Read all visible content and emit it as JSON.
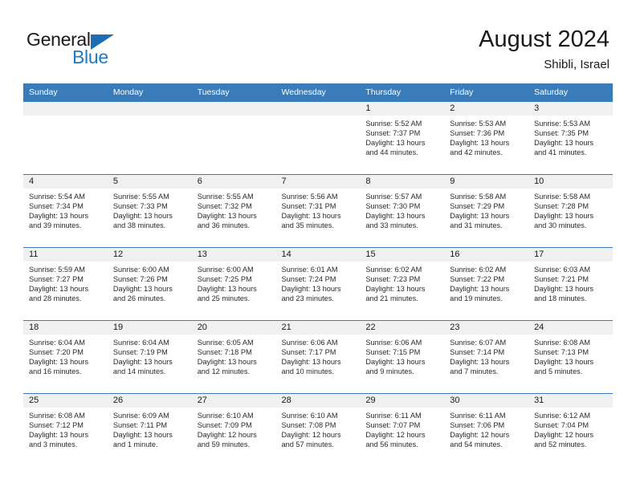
{
  "brand": {
    "line1": "General",
    "line2": "Blue",
    "triangle_color": "#1d6cb5",
    "blue_text_color": "#2278c4"
  },
  "header": {
    "title": "August 2024",
    "subtitle": "Shibli, Israel",
    "accent_color": "#3a7cba"
  },
  "weekday_headers": [
    "Sunday",
    "Monday",
    "Tuesday",
    "Wednesday",
    "Thursday",
    "Friday",
    "Saturday"
  ],
  "labels": {
    "sunrise_prefix": "Sunrise:",
    "sunset_prefix": "Sunset:",
    "daylight_prefix": "Daylight:"
  },
  "weeks": [
    [
      {
        "day": ""
      },
      {
        "day": ""
      },
      {
        "day": ""
      },
      {
        "day": ""
      },
      {
        "day": "1",
        "sunrise": "Sunrise: 5:52 AM",
        "sunset": "Sunset: 7:37 PM",
        "daylight1": "Daylight: 13 hours",
        "daylight2": "and 44 minutes."
      },
      {
        "day": "2",
        "sunrise": "Sunrise: 5:53 AM",
        "sunset": "Sunset: 7:36 PM",
        "daylight1": "Daylight: 13 hours",
        "daylight2": "and 42 minutes."
      },
      {
        "day": "3",
        "sunrise": "Sunrise: 5:53 AM",
        "sunset": "Sunset: 7:35 PM",
        "daylight1": "Daylight: 13 hours",
        "daylight2": "and 41 minutes."
      }
    ],
    [
      {
        "day": "4",
        "sunrise": "Sunrise: 5:54 AM",
        "sunset": "Sunset: 7:34 PM",
        "daylight1": "Daylight: 13 hours",
        "daylight2": "and 39 minutes."
      },
      {
        "day": "5",
        "sunrise": "Sunrise: 5:55 AM",
        "sunset": "Sunset: 7:33 PM",
        "daylight1": "Daylight: 13 hours",
        "daylight2": "and 38 minutes."
      },
      {
        "day": "6",
        "sunrise": "Sunrise: 5:55 AM",
        "sunset": "Sunset: 7:32 PM",
        "daylight1": "Daylight: 13 hours",
        "daylight2": "and 36 minutes."
      },
      {
        "day": "7",
        "sunrise": "Sunrise: 5:56 AM",
        "sunset": "Sunset: 7:31 PM",
        "daylight1": "Daylight: 13 hours",
        "daylight2": "and 35 minutes."
      },
      {
        "day": "8",
        "sunrise": "Sunrise: 5:57 AM",
        "sunset": "Sunset: 7:30 PM",
        "daylight1": "Daylight: 13 hours",
        "daylight2": "and 33 minutes."
      },
      {
        "day": "9",
        "sunrise": "Sunrise: 5:58 AM",
        "sunset": "Sunset: 7:29 PM",
        "daylight1": "Daylight: 13 hours",
        "daylight2": "and 31 minutes."
      },
      {
        "day": "10",
        "sunrise": "Sunrise: 5:58 AM",
        "sunset": "Sunset: 7:28 PM",
        "daylight1": "Daylight: 13 hours",
        "daylight2": "and 30 minutes."
      }
    ],
    [
      {
        "day": "11",
        "sunrise": "Sunrise: 5:59 AM",
        "sunset": "Sunset: 7:27 PM",
        "daylight1": "Daylight: 13 hours",
        "daylight2": "and 28 minutes."
      },
      {
        "day": "12",
        "sunrise": "Sunrise: 6:00 AM",
        "sunset": "Sunset: 7:26 PM",
        "daylight1": "Daylight: 13 hours",
        "daylight2": "and 26 minutes."
      },
      {
        "day": "13",
        "sunrise": "Sunrise: 6:00 AM",
        "sunset": "Sunset: 7:25 PM",
        "daylight1": "Daylight: 13 hours",
        "daylight2": "and 25 minutes."
      },
      {
        "day": "14",
        "sunrise": "Sunrise: 6:01 AM",
        "sunset": "Sunset: 7:24 PM",
        "daylight1": "Daylight: 13 hours",
        "daylight2": "and 23 minutes."
      },
      {
        "day": "15",
        "sunrise": "Sunrise: 6:02 AM",
        "sunset": "Sunset: 7:23 PM",
        "daylight1": "Daylight: 13 hours",
        "daylight2": "and 21 minutes."
      },
      {
        "day": "16",
        "sunrise": "Sunrise: 6:02 AM",
        "sunset": "Sunset: 7:22 PM",
        "daylight1": "Daylight: 13 hours",
        "daylight2": "and 19 minutes."
      },
      {
        "day": "17",
        "sunrise": "Sunrise: 6:03 AM",
        "sunset": "Sunset: 7:21 PM",
        "daylight1": "Daylight: 13 hours",
        "daylight2": "and 18 minutes."
      }
    ],
    [
      {
        "day": "18",
        "sunrise": "Sunrise: 6:04 AM",
        "sunset": "Sunset: 7:20 PM",
        "daylight1": "Daylight: 13 hours",
        "daylight2": "and 16 minutes."
      },
      {
        "day": "19",
        "sunrise": "Sunrise: 6:04 AM",
        "sunset": "Sunset: 7:19 PM",
        "daylight1": "Daylight: 13 hours",
        "daylight2": "and 14 minutes."
      },
      {
        "day": "20",
        "sunrise": "Sunrise: 6:05 AM",
        "sunset": "Sunset: 7:18 PM",
        "daylight1": "Daylight: 13 hours",
        "daylight2": "and 12 minutes."
      },
      {
        "day": "21",
        "sunrise": "Sunrise: 6:06 AM",
        "sunset": "Sunset: 7:17 PM",
        "daylight1": "Daylight: 13 hours",
        "daylight2": "and 10 minutes."
      },
      {
        "day": "22",
        "sunrise": "Sunrise: 6:06 AM",
        "sunset": "Sunset: 7:15 PM",
        "daylight1": "Daylight: 13 hours",
        "daylight2": "and 9 minutes."
      },
      {
        "day": "23",
        "sunrise": "Sunrise: 6:07 AM",
        "sunset": "Sunset: 7:14 PM",
        "daylight1": "Daylight: 13 hours",
        "daylight2": "and 7 minutes."
      },
      {
        "day": "24",
        "sunrise": "Sunrise: 6:08 AM",
        "sunset": "Sunset: 7:13 PM",
        "daylight1": "Daylight: 13 hours",
        "daylight2": "and 5 minutes."
      }
    ],
    [
      {
        "day": "25",
        "sunrise": "Sunrise: 6:08 AM",
        "sunset": "Sunset: 7:12 PM",
        "daylight1": "Daylight: 13 hours",
        "daylight2": "and 3 minutes."
      },
      {
        "day": "26",
        "sunrise": "Sunrise: 6:09 AM",
        "sunset": "Sunset: 7:11 PM",
        "daylight1": "Daylight: 13 hours",
        "daylight2": "and 1 minute."
      },
      {
        "day": "27",
        "sunrise": "Sunrise: 6:10 AM",
        "sunset": "Sunset: 7:09 PM",
        "daylight1": "Daylight: 12 hours",
        "daylight2": "and 59 minutes."
      },
      {
        "day": "28",
        "sunrise": "Sunrise: 6:10 AM",
        "sunset": "Sunset: 7:08 PM",
        "daylight1": "Daylight: 12 hours",
        "daylight2": "and 57 minutes."
      },
      {
        "day": "29",
        "sunrise": "Sunrise: 6:11 AM",
        "sunset": "Sunset: 7:07 PM",
        "daylight1": "Daylight: 12 hours",
        "daylight2": "and 56 minutes."
      },
      {
        "day": "30",
        "sunrise": "Sunrise: 6:11 AM",
        "sunset": "Sunset: 7:06 PM",
        "daylight1": "Daylight: 12 hours",
        "daylight2": "and 54 minutes."
      },
      {
        "day": "31",
        "sunrise": "Sunrise: 6:12 AM",
        "sunset": "Sunset: 7:04 PM",
        "daylight1": "Daylight: 12 hours",
        "daylight2": "and 52 minutes."
      }
    ]
  ]
}
